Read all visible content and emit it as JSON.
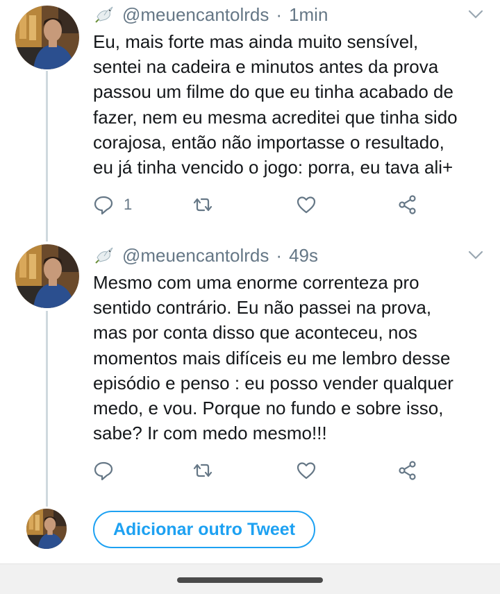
{
  "colors": {
    "accent": "#1da1f2",
    "muted": "#657786",
    "text": "#14171a",
    "thread_line": "#cfd9de"
  },
  "tweets": [
    {
      "handle": "@meuencantolrds",
      "separator": "·",
      "time": "1min",
      "text": "Eu, mais forte mas ainda muito sensível,\nsentei na cadeira e minutos antes da prova\npassou um filme do que eu tinha acabado de\nfazer, nem eu mesma acreditei que tinha sido\ncorajosa, então não importasse o resultado,\neu já tinha vencido o jogo: porra, eu tava ali+",
      "reply_count": "1",
      "icons": [
        "reply-icon",
        "retweet-icon",
        "like-icon",
        "share-icon"
      ]
    },
    {
      "handle": "@meuencantolrds",
      "separator": "·",
      "time": "49s",
      "text": "Mesmo com uma enorme correnteza pro\nsentido contrário. Eu não passei na prova,\nmas por conta disso que aconteceu, nos\nmomentos mais difíceis eu me lembro desse\nepisódio e penso : eu posso vender qualquer\nmedo, e vou. Porque no fundo e sobre isso,\nsabe? Ir com medo mesmo!!!",
      "reply_count": "",
      "icons": [
        "reply-icon",
        "retweet-icon",
        "like-icon",
        "share-icon"
      ]
    }
  ],
  "add_tweet": {
    "button_label": "Adicionar outro Tweet"
  }
}
